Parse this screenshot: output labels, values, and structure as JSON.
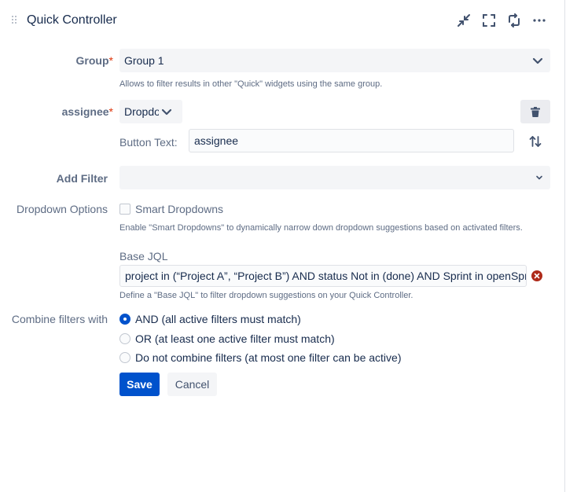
{
  "header": {
    "title": "Quick Controller",
    "icons": [
      "collapse-icon",
      "fullscreen-icon",
      "refresh-icon",
      "more-icon"
    ]
  },
  "group": {
    "label": "Group",
    "required_mark": "*",
    "value": "Group 1",
    "help": "Allows to filter results in other \"Quick\" widgets using the same group."
  },
  "assignee": {
    "label": "assignee",
    "required_mark": "*",
    "type_value": "Dropdown",
    "button_text_label": "Button Text:",
    "button_text_value": "assignee"
  },
  "add_filter": {
    "label": "Add Filter",
    "value": ""
  },
  "dropdown_options": {
    "label": "Dropdown Options",
    "smart_label": "Smart Dropdowns",
    "smart_checked": false,
    "help": "Enable \"Smart Dropdowns\" to dynamically narrow down dropdown suggestions based on activated filters."
  },
  "base_jql": {
    "label": "Base JQL",
    "value": "project in (“Project A”, “Project B”) AND status Not in (done) AND Sprint in openSprints()",
    "help": "Define a \"Base JQL\" to filter dropdown suggestions on your Quick Controller."
  },
  "combine": {
    "label": "Combine filters with",
    "options": [
      {
        "label": "AND (all active filters must match)",
        "checked": true
      },
      {
        "label": "OR (at least one active filter must match)",
        "checked": false
      },
      {
        "label": "Do not combine filters (at most one filter can be active)",
        "checked": false
      }
    ]
  },
  "actions": {
    "save": "Save",
    "cancel": "Cancel"
  },
  "colors": {
    "primary": "#0052cc",
    "required": "#de350b",
    "error": "#ae2a19",
    "field_bg": "#f4f5f7"
  }
}
